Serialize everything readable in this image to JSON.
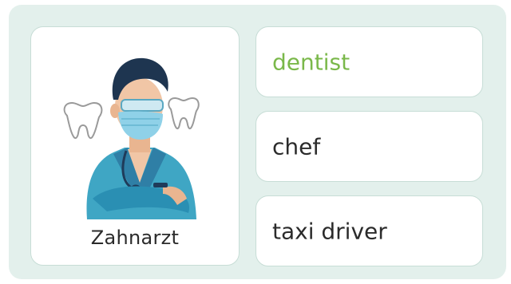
{
  "colors": {
    "panel_bg": "#e3f0ec",
    "card_border": "#c7ddd6",
    "correct_text": "#7ab84a",
    "text": "#2b2b2b"
  },
  "prompt": {
    "image_icon": "dentist-illustration",
    "word": "Zahnarzt"
  },
  "options": [
    {
      "label": "dentist",
      "state": "correct"
    },
    {
      "label": "chef",
      "state": "default"
    },
    {
      "label": "taxi driver",
      "state": "default"
    }
  ]
}
